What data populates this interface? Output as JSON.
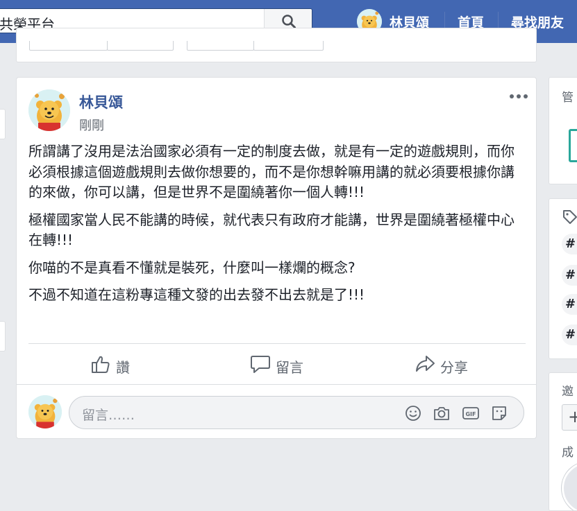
{
  "topbar": {
    "search_value": "共榮平台",
    "user_name": "林貝頌",
    "home_label": "首頁",
    "find_friends_label": "尋找朋友"
  },
  "post": {
    "author": "林貝頌",
    "time": "剛剛",
    "paragraphs": [
      "所謂講了沒用是法治國家必須有一定的制度去做，就是有一定的遊戲規則，而你必須根據這個遊戲規則去做你想要的，而不是你想幹嘛用講的就必須要根據你講的來做，你可以講，但是世界不是圍繞著你一個人轉!!!",
      "極權國家當人民不能講的時候，就代表只有政府才能講，世界是圍繞著極權中心在轉!!!",
      "你喵的不是真看不懂就是裝死，什麼叫一樣爛的概念?",
      "不過不知道在這粉專這種文發的出去發不出去就是了!!!"
    ],
    "actions": {
      "like": "讚",
      "comment": "留言",
      "share": "分享"
    },
    "comment_placeholder": "留言……"
  },
  "right_rail": {
    "manage_label": "管",
    "tags": [
      "#",
      "#",
      "#",
      "#"
    ],
    "invite_label": "邀",
    "plus": "+",
    "member_label": "成"
  },
  "colors": {
    "brand_blue": "#4267b2",
    "link_blue": "#385898",
    "bg": "#e9ebee"
  }
}
